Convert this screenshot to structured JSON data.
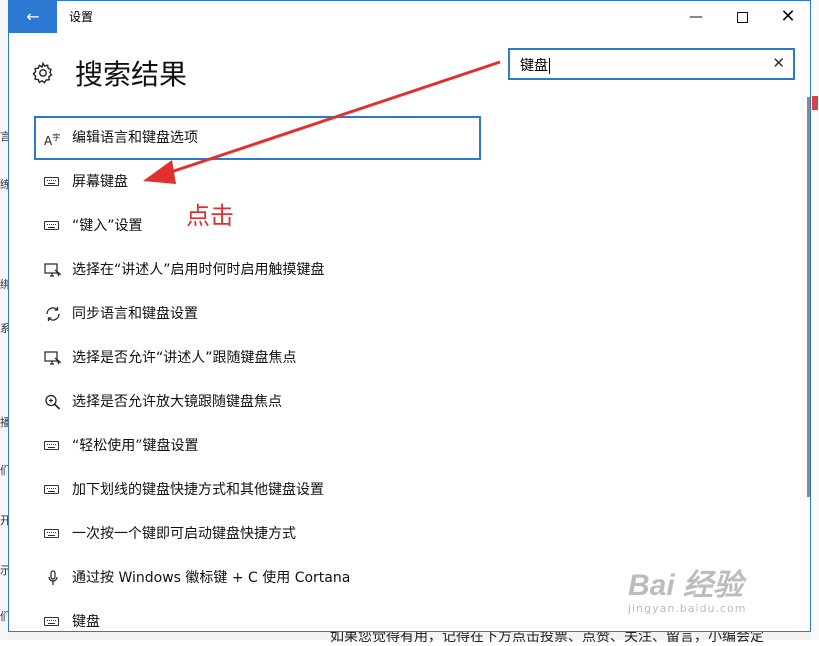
{
  "window": {
    "title": "设置",
    "back_icon": "arrow-left-icon",
    "min_glyph": "—",
    "close_glyph": "✕",
    "accent": "#2b79d3"
  },
  "page": {
    "title": "搜索结果"
  },
  "search": {
    "value": "键盘",
    "clear_glyph": "✕"
  },
  "results": [
    {
      "label": "编辑语言和键盘选项",
      "icon": "language-icon",
      "selected": true
    },
    {
      "label": "屏幕键盘",
      "icon": "keyboard-icon"
    },
    {
      "label": "“键入”设置",
      "icon": "keyboard-icon"
    },
    {
      "label": "选择在“讲述人”启用时何时启用触摸键盘",
      "icon": "narrator-icon"
    },
    {
      "label": "同步语言和键盘设置",
      "icon": "sync-icon"
    },
    {
      "label": "选择是否允许“讲述人”跟随键盘焦点",
      "icon": "narrator-icon"
    },
    {
      "label": "选择是否允许放大镜跟随键盘焦点",
      "icon": "magnifier-icon"
    },
    {
      "label": "“轻松使用”键盘设置",
      "icon": "keyboard-icon"
    },
    {
      "label": "加下划线的键盘快捷方式和其他键盘设置",
      "icon": "keyboard-icon"
    },
    {
      "label": "一次按一个键即可启动键盘快捷方式",
      "icon": "keyboard-icon"
    },
    {
      "label": "通过按 Windows 徽标键 + C 使用 Cortana",
      "icon": "microphone-icon"
    },
    {
      "label": "键盘",
      "icon": "keyboard-icon"
    }
  ],
  "annotation": {
    "text": "点击",
    "color": "#e03030"
  },
  "background": {
    "left_fragments": [
      "言",
      "练",
      "绑",
      "系",
      "播",
      "们",
      "开",
      "示",
      "们"
    ],
    "bottom_text": "如果您觉得有用，记得在下方点击投票、点赞、关注、留言，小编会定"
  },
  "watermark": {
    "brand": "Bai 经验",
    "sub": "jingyan.baidu.com"
  }
}
